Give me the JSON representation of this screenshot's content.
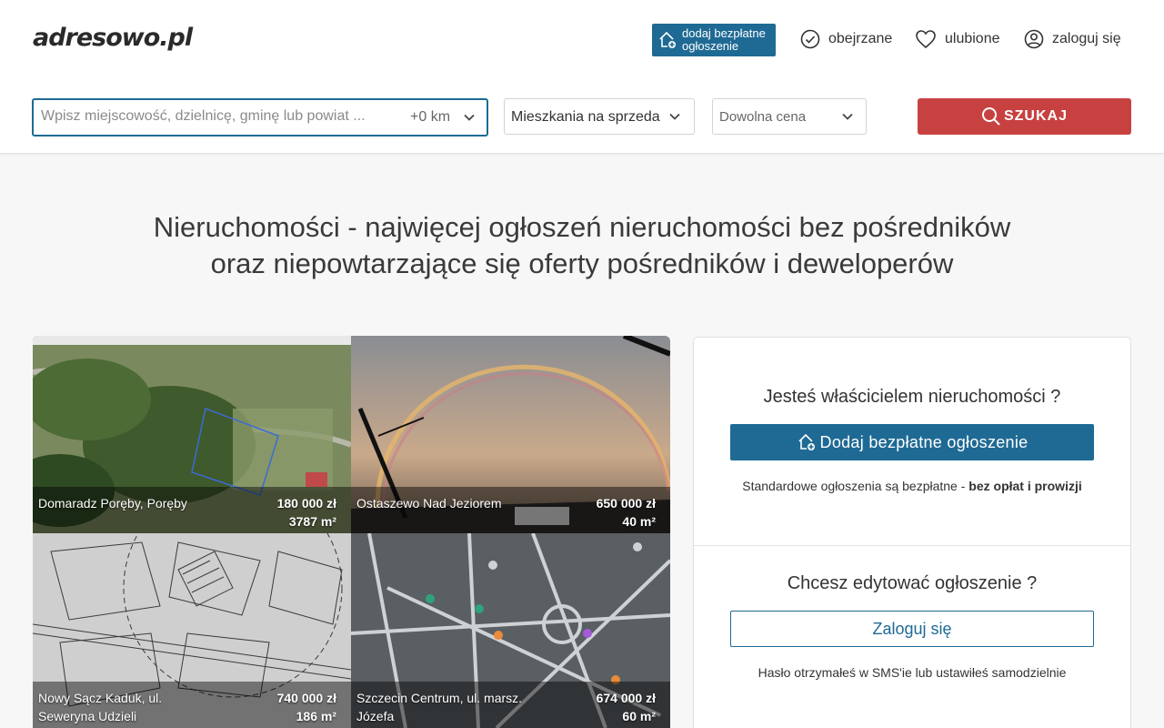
{
  "header": {
    "logo": "adresowo.pl",
    "add_listing": {
      "line1": "dodaj bezpłatne",
      "line2": "ogłoszenie"
    },
    "nav": {
      "viewed": "obejrzane",
      "favorites": "ulubione",
      "login": "zaloguj się"
    }
  },
  "search": {
    "placeholder": "Wpisz miejscowość, dzielnicę, gminę lub powiat ...",
    "value": "",
    "radius": "+0 km",
    "property_type": "Mieszkania na sprzeda",
    "price": "Dowolna cena",
    "button": "SZUKAJ"
  },
  "headline": {
    "line1": "Nieruchomości - najwięcej ogłoszeń nieruchomości bez pośredników",
    "line2": "oraz niepowtarzające się oferty pośredników i deweloperów"
  },
  "listings": [
    {
      "location": "Domaradz Poręby, Poręby",
      "price": "180 000 zł",
      "area": "3787 m²"
    },
    {
      "location": "Ostaszewo Nad Jeziorem",
      "price": "650 000 zł",
      "area": "40 m²"
    },
    {
      "location": "Nowy Sącz Kaduk, ul. Seweryna Udzieli",
      "price": "740 000 zł",
      "area": "186 m²"
    },
    {
      "location": "Szczecin Centrum, ul. marsz. Józefa",
      "price": "674 000 zł",
      "area": "60 m²"
    }
  ],
  "owner_panel": {
    "question": "Jesteś właścicielem nieruchomości ?",
    "add_button": "Dodaj bezpłatne ogłoszenie",
    "note_prefix": "Standardowe ogłoszenia są bezpłatne - ",
    "note_bold": "bez opłat i prowizji"
  },
  "edit_panel": {
    "question": "Chcesz edytować ogłoszenie ?",
    "login_button": "Zaloguj się",
    "note": "Hasło otrzymałeś w SMS'ie lub ustawiłeś samodzielnie"
  },
  "colors": {
    "primary": "#1f6a94",
    "search_button": "#c84141"
  }
}
